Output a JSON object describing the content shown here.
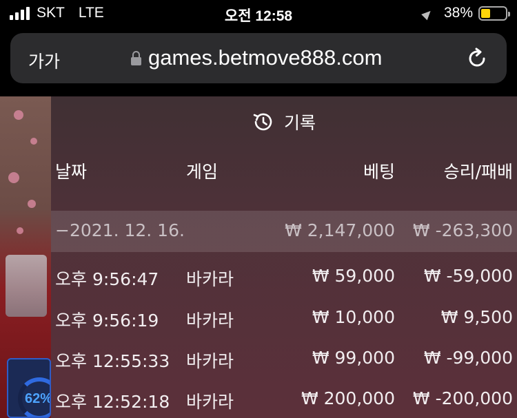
{
  "status_bar": {
    "carrier": "SKT",
    "network": "LTE",
    "time": "오전 12:58",
    "battery_percent": "38%",
    "battery_level": 0.38
  },
  "browser": {
    "text_size_button": "가가",
    "url": "games.betmove888.com",
    "lock_icon": "lock-icon",
    "reload_icon": "reload-icon"
  },
  "game": {
    "progress_text": "62%"
  },
  "history": {
    "icon": "history-icon",
    "title": "기록",
    "columns": {
      "date": "날짜",
      "game": "게임",
      "bet": "베팅",
      "result": "승리/패배"
    },
    "summary": {
      "date": "−2021. 12. 16.",
      "bet": "₩ 2,147,000",
      "result": "₩ -263,300"
    },
    "rows": [
      {
        "time": "오후 9:56:47",
        "game": "바카라",
        "bet": "₩ 59,000",
        "result": "₩ -59,000"
      },
      {
        "time": "오후 9:56:19",
        "game": "바카라",
        "bet": "₩ 10,000",
        "result": "₩ 9,500"
      },
      {
        "time": "오후 12:55:33",
        "game": "바카라",
        "bet": "₩ 99,000",
        "result": "₩ -99,000"
      },
      {
        "time": "오후 12:52:18",
        "game": "바카라",
        "bet": "₩ 200,000",
        "result": "₩ -200,000"
      }
    ]
  }
}
